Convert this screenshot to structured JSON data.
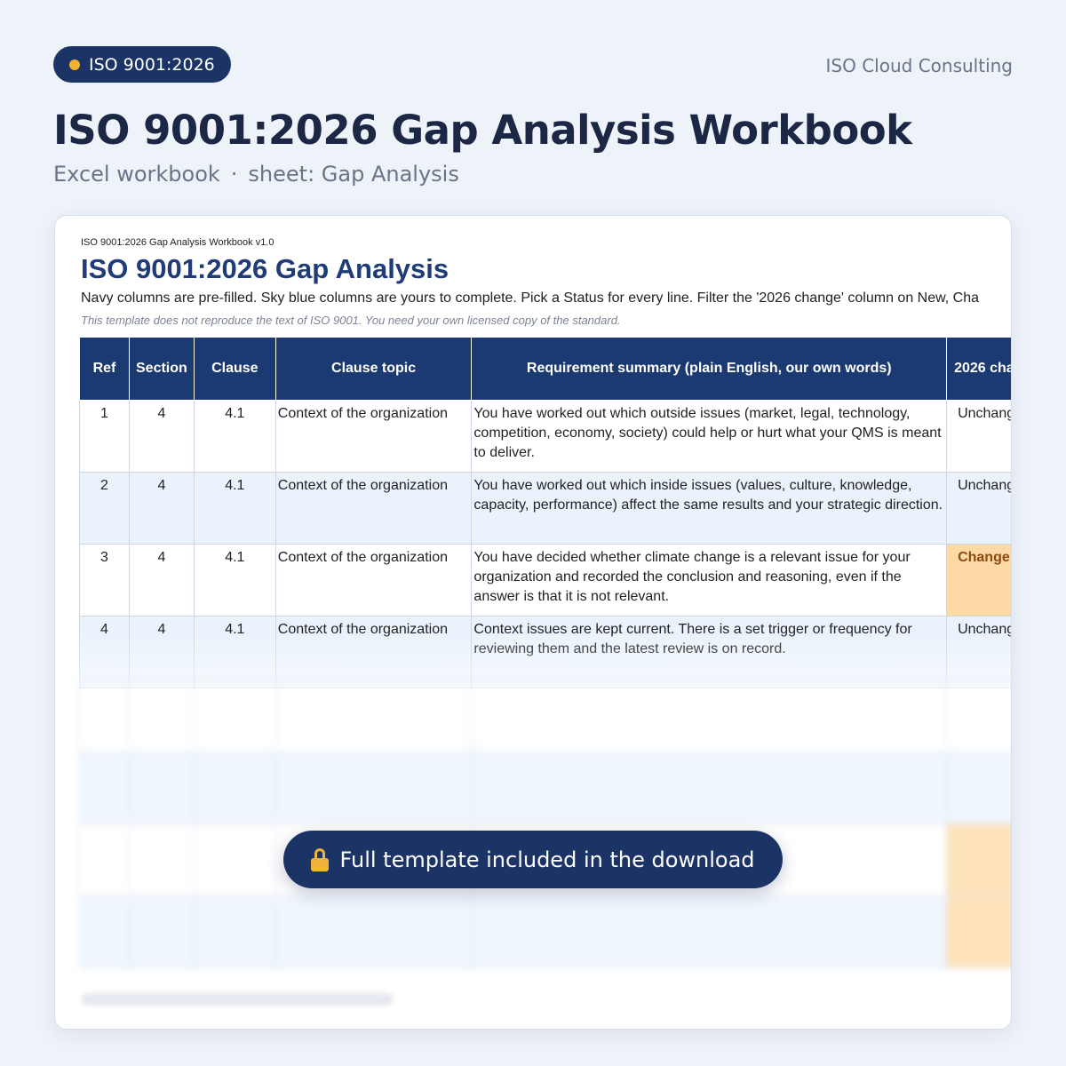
{
  "badge": {
    "label": "ISO 9001:2026"
  },
  "brand": "ISO Cloud Consulting",
  "title": "ISO 9001:2026 Gap Analysis Workbook",
  "subtitle": {
    "kind": "Excel workbook",
    "separator": "·",
    "sheet": "sheet: Gap Analysis"
  },
  "sheet": {
    "version": "ISO 9001:2026 Gap Analysis Workbook v1.0",
    "title": "ISO 9001:2026 Gap Analysis",
    "instructions": "Navy columns are pre-filled. Sky blue columns are yours to complete. Pick a Status for every line. Filter the '2026 change' column on New, Cha",
    "note": "This template does not reproduce the text of ISO 9001. You need your own licensed copy of the standard.",
    "headers": [
      "Ref",
      "Section",
      "Clause",
      "Clause topic",
      "Requirement summary (plain English, our own words)",
      "2026 cha"
    ],
    "rows": [
      {
        "ref": "1",
        "section": "4",
        "clause": "4.1",
        "topic": "Context of the organization",
        "summary": "You have worked out which outside issues (market, legal, technology, competition, economy, society) could help or hurt what your QMS is meant to deliver.",
        "change": "Unchang"
      },
      {
        "ref": "2",
        "section": "4",
        "clause": "4.1",
        "topic": "Context of the organization",
        "summary": "You have worked out which inside issues (values, culture, knowledge, capacity, performance) affect the same results and your strategic direction.",
        "change": "Unchang"
      },
      {
        "ref": "3",
        "section": "4",
        "clause": "4.1",
        "topic": "Context of the organization",
        "summary": "You have decided whether climate change is a relevant issue for your organization and recorded the conclusion and reasoning, even if the answer is that it is not relevant.",
        "change": "Change"
      },
      {
        "ref": "4",
        "section": "4",
        "clause": "4.1",
        "topic": "Context of the organization",
        "summary": "Context issues are kept current. There is a set trigger or frequency for reviewing them and the latest review is on record.",
        "change": "Unchang"
      }
    ]
  },
  "cta": {
    "label": "Full template included in the download",
    "icon": "lock-icon"
  },
  "colors": {
    "navy": "#1c3366",
    "header": "#1c3a72",
    "sky": "#eaf3fc",
    "changed": "#fdd9a5",
    "accent": "#f2b233"
  }
}
